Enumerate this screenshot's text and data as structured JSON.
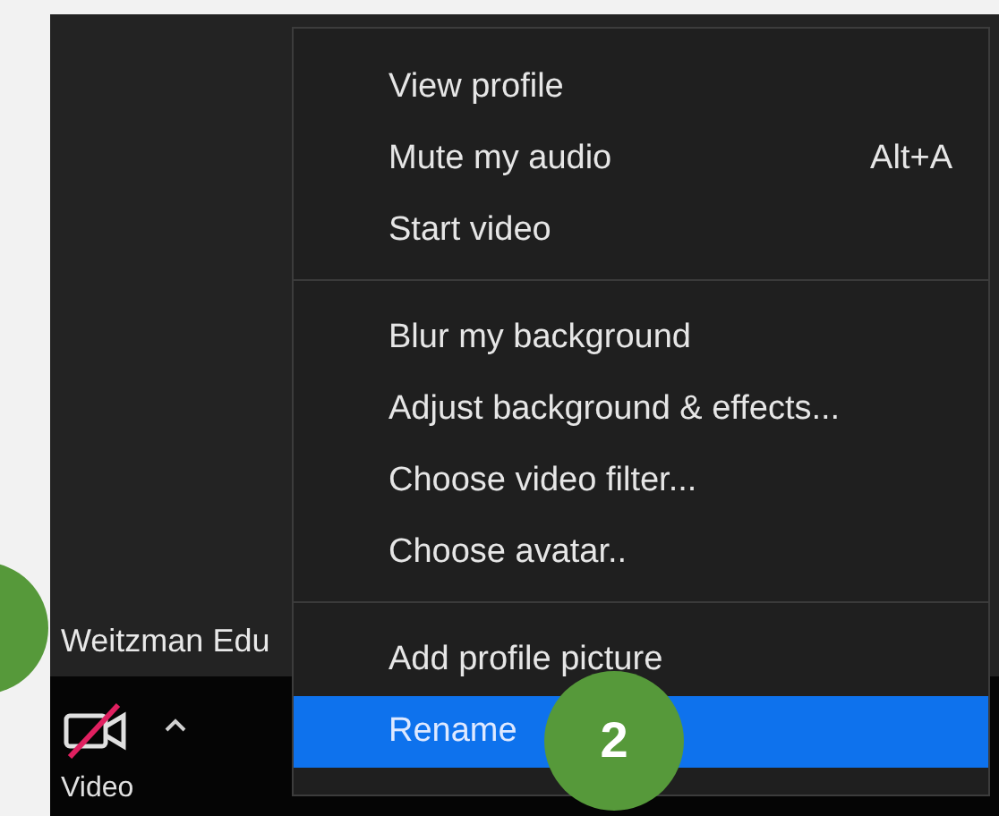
{
  "participant": {
    "name": "Weitzman Edu"
  },
  "toolbar": {
    "video_button": {
      "label": "Video",
      "muted": true
    }
  },
  "menu": {
    "groups": [
      [
        {
          "label": "View profile",
          "selected": false
        },
        {
          "label": "Mute my audio",
          "shortcut": "Alt+A",
          "selected": false
        },
        {
          "label": "Start video",
          "selected": false
        }
      ],
      [
        {
          "label": "Blur my background",
          "selected": false
        },
        {
          "label": "Adjust background & effects...",
          "selected": false
        },
        {
          "label": "Choose video filter...",
          "selected": false
        },
        {
          "label": "Choose avatar..",
          "selected": false
        }
      ],
      [
        {
          "label": "Add profile picture",
          "selected": false
        },
        {
          "label": "Rename",
          "selected": true
        }
      ]
    ]
  },
  "callouts": [
    {
      "label": "2"
    }
  ]
}
